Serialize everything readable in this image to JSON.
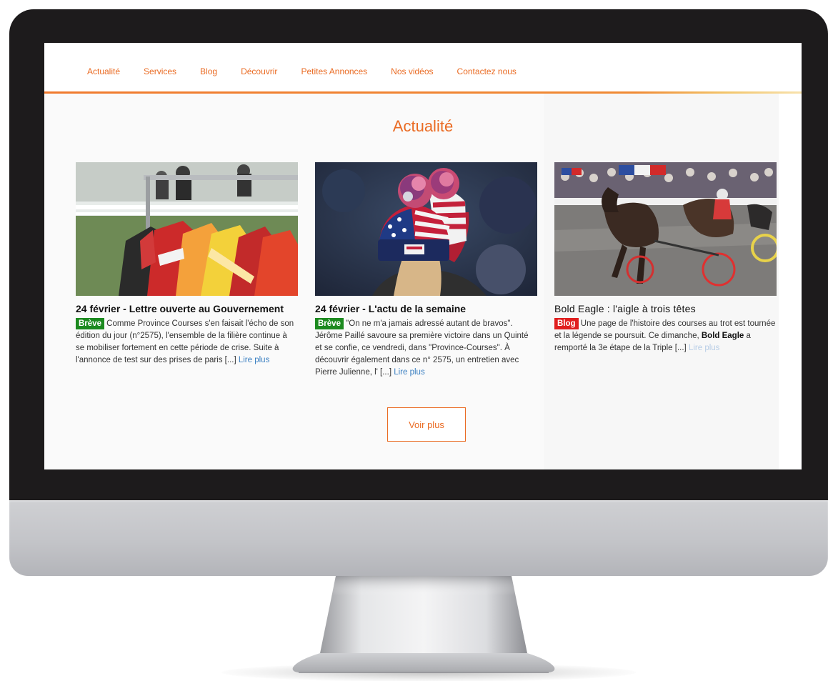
{
  "nav": {
    "items": [
      {
        "label": "Actualité"
      },
      {
        "label": "Services"
      },
      {
        "label": "Blog"
      },
      {
        "label": "Découvrir"
      },
      {
        "label": "Petites Annonces"
      },
      {
        "label": "Nos vidéos"
      },
      {
        "label": "Contactez nous"
      }
    ]
  },
  "section": {
    "title": "Actualité",
    "more_label": "Voir plus"
  },
  "cards": [
    {
      "title": "24 février - Lettre ouverte au Gouvernement",
      "badge": "Brève",
      "text": "Comme Province Courses s'en faisait l'écho de son édition du jour (n°2575), l'ensemble de la filière continue à se mobiliser fortement en cette période de crise. Suite à l'annonce de test sur des prises de paris [...]",
      "read_more": "Lire plus",
      "image": "jockey-silks-on-rack"
    },
    {
      "title": "24 février - L'actu de la semaine",
      "badge": "Brève",
      "text": "\"On ne m'a jamais adressé autant de bravos\". Jérôme Paillé savoure sa première victoire dans un Quinté et se confie, ce vendredi, dans \"Province-Courses\". À découvrir également dans ce n° 2575, un entretien avec Pierre Julienne, l' [...]",
      "read_more": "Lire plus",
      "image": "american-flag-beanies"
    },
    {
      "title": "Bold Eagle : l'aigle à trois têtes",
      "badge": "Blog",
      "text_1": "Une page de l'histoire des courses au trot est tournée et la légende se poursuit. Ce dimanche,",
      "text_strong": "Bold Eagle",
      "text_2": "a remporté la 3e étape de la Triple [...]",
      "read_more": "Lire plus",
      "image": "harness-racing-horses"
    }
  ],
  "colors": {
    "accent": "#ea6b23",
    "badge_breve": "#1c8a1f",
    "badge_blog": "#e01e1e",
    "link": "#3a7fc1",
    "bezel": "#1d1b1c"
  }
}
